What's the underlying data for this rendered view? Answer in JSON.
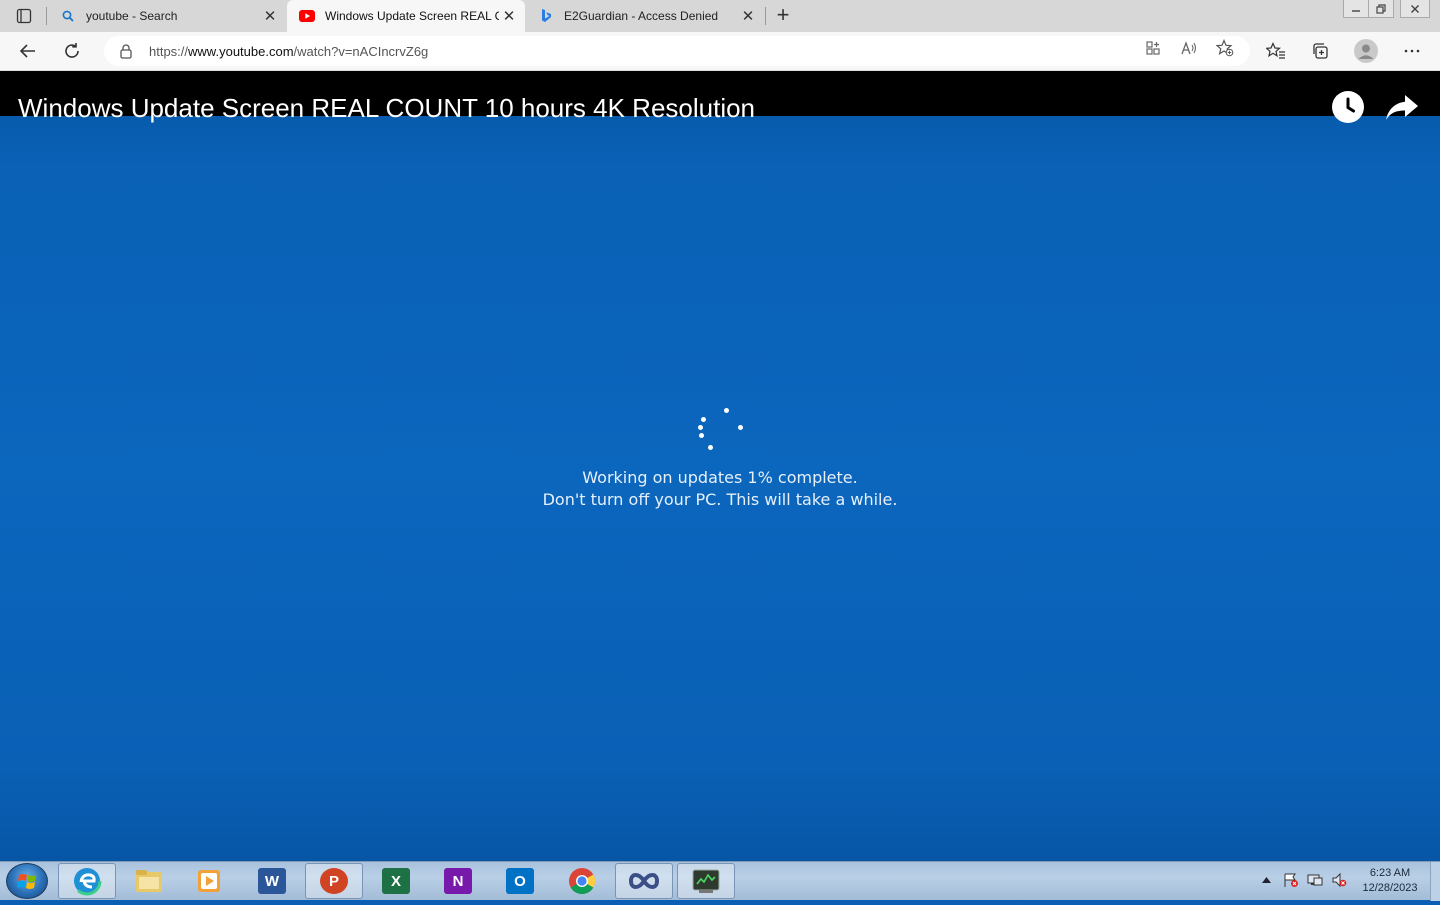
{
  "browser": {
    "tabs": [
      {
        "title": "youtube - Search",
        "favicon": "search-icon"
      },
      {
        "title": "Windows Update Screen REAL C",
        "favicon": "youtube-icon"
      },
      {
        "title": "E2Guardian - Access Denied",
        "favicon": "bing-icon"
      }
    ],
    "new_tab": "+",
    "close_glyph": "✕",
    "url_prefix": "https://",
    "url_host": "www.youtube.com",
    "url_path": "/watch?v=nACIncrvZ6g"
  },
  "video": {
    "title": "Windows Update Screen REAL COUNT 10 hours 4K Resolution",
    "message_line1": "Working on updates 1% complete.",
    "message_line2": "Don't turn off your PC. This will take a while.",
    "background_color": "#0b66bd"
  },
  "taskbar": {
    "apps": [
      {
        "name": "edge",
        "label": "",
        "color": "#1f8fd6"
      },
      {
        "name": "file-explorer",
        "label": "",
        "color": "#e8c96a"
      },
      {
        "name": "media-player",
        "label": "",
        "color": "#f3a23a"
      },
      {
        "name": "word",
        "label": "W",
        "color": "#2b579a"
      },
      {
        "name": "powerpoint",
        "label": "P",
        "color": "#d04423"
      },
      {
        "name": "excel",
        "label": "X",
        "color": "#1e7145"
      },
      {
        "name": "onenote",
        "label": "N",
        "color": "#7719aa"
      },
      {
        "name": "outlook",
        "label": "O",
        "color": "#0072c6"
      },
      {
        "name": "chrome",
        "label": "",
        "color": "#db4437"
      },
      {
        "name": "infinity-app",
        "label": "",
        "color": "#3b4f86"
      },
      {
        "name": "terminal-app",
        "label": "",
        "color": "#3a7a3a"
      }
    ],
    "time": "6:23 AM",
    "date": "12/28/2023"
  }
}
